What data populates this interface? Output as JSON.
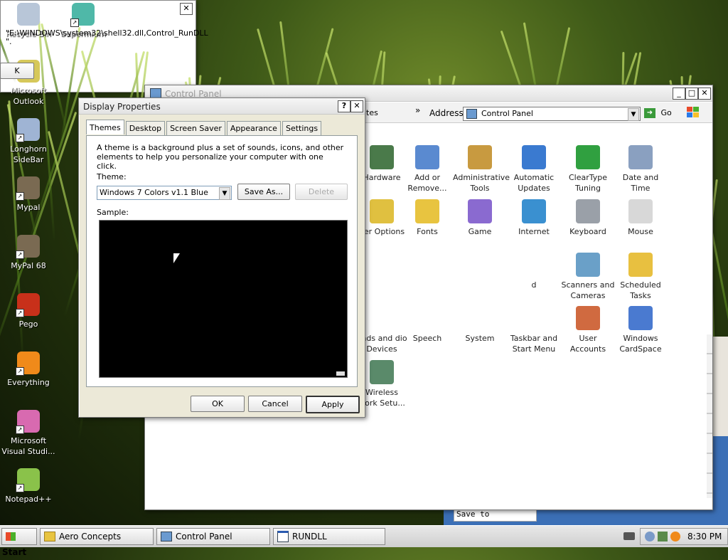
{
  "desktop": {
    "icons": [
      {
        "label": "Recycle Bin",
        "icon": "recycle-bin-icon",
        "color": "#b8c6d8",
        "shortcut": false
      },
      {
        "label": "Supermium",
        "icon": "supermium-icon",
        "color": "#4fb8a8",
        "shortcut": true
      },
      {
        "label": "Microsoft Outlook",
        "icon": "outlook-icon",
        "color": "#d6c85a",
        "shortcut": false
      },
      {
        "label": "Longhorn SideBar",
        "icon": "sidebar-icon",
        "color": "#9fb4d4",
        "shortcut": true
      },
      {
        "label": "Mypal",
        "icon": "mypal-icon",
        "color": "#7a6a52",
        "shortcut": true
      },
      {
        "label": "MyPal 68",
        "icon": "mypal-icon",
        "color": "#7a6a52",
        "shortcut": true
      },
      {
        "label": "Pego",
        "icon": "pego-icon",
        "color": "#c8301a",
        "shortcut": true
      },
      {
        "label": "Everything",
        "icon": "everything-icon",
        "color": "#f08a1a",
        "shortcut": true
      },
      {
        "label": "Microsoft Visual Studi...",
        "icon": "visual-studio-icon",
        "color": "#d86ab0",
        "shortcut": true
      },
      {
        "label": "Notepad++",
        "icon": "notepadpp-icon",
        "color": "#8ac24a",
        "shortcut": true
      }
    ]
  },
  "control_panel": {
    "title": "Control Panel",
    "toolbar_fragment": "ites",
    "address_label": "Address",
    "address_value": "Control Panel",
    "go_label": "Go",
    "items": [
      {
        "label": "Hardware",
        "color": "#4a7a4a"
      },
      {
        "label": "Add or Remove...",
        "color": "#5a8ad0"
      },
      {
        "label": "Administrative Tools",
        "color": "#c89a40"
      },
      {
        "label": "Automatic Updates",
        "color": "#3a7ad0"
      },
      {
        "label": "ClearType Tuning",
        "color": "#30a040"
      },
      {
        "label": "Date and Time",
        "color": "#8aa0c0"
      },
      {
        "label": "der Options",
        "color": "#e0c040"
      },
      {
        "label": "Fonts",
        "color": "#e8c440"
      },
      {
        "label": "Game",
        "color": "#8a6ad0"
      },
      {
        "label": "Internet",
        "color": "#3a90d0"
      },
      {
        "label": "Keyboard",
        "color": "#9aa0a8"
      },
      {
        "label": "Mouse",
        "color": "#d8d8d8"
      },
      {
        "label": "d",
        "color": "#ffffff"
      },
      {
        "label": "Scanners and Cameras",
        "color": "#6aa0c8"
      },
      {
        "label": "Scheduled Tasks",
        "color": "#e8c040"
      },
      {
        "label": "unds and dio Devices",
        "color": "#ffffff"
      },
      {
        "label": "Speech",
        "color": "#ffffff"
      },
      {
        "label": "System",
        "color": "#ffffff"
      },
      {
        "label": "Taskbar and Start Menu",
        "color": "#ffffff"
      },
      {
        "label": "User Accounts",
        "color": "#d06a40"
      },
      {
        "label": "Windows CardSpace",
        "color": "#4a7ad0"
      },
      {
        "label": "Wireless work Setu...",
        "color": "#5a8a6a"
      }
    ]
  },
  "rundll": {
    "message": "\"E:\\WINDOWS\\system32\\shell32.dll,Control_RunDLL",
    "message2": "\".",
    "ok_label": "K"
  },
  "display_properties": {
    "title": "Display Properties",
    "tabs": [
      "Themes",
      "Desktop",
      "Screen Saver",
      "Appearance",
      "Settings"
    ],
    "description": "A theme is a background plus a set of sounds, icons, and other elements to help you personalize your computer with one click.",
    "theme_label": "Theme:",
    "theme_value": "Windows 7 Colors v1.1 Blue",
    "save_as_label": "Save As...",
    "delete_label": "Delete",
    "sample_label": "Sample:",
    "ok_label": "OK",
    "cancel_label": "Cancel",
    "apply_label": "Apply"
  },
  "background_window": {
    "text": "Save to"
  },
  "taskbar": {
    "start_label": "Start",
    "buttons": [
      "Aero Concepts",
      "Control Panel",
      "RUNDLL"
    ],
    "clock": "8:30 PM"
  }
}
